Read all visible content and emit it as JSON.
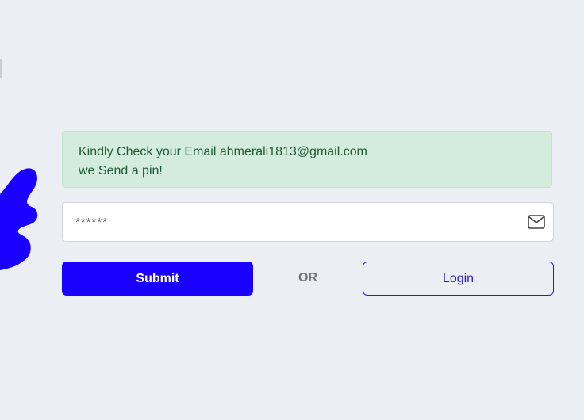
{
  "alert": {
    "line1": "Kindly Check your Email ahmerali1813@gmail.com",
    "line2": "we Send a pin!"
  },
  "pin_input": {
    "placeholder": "******",
    "value": "",
    "icon": "mail-icon"
  },
  "actions": {
    "submit_label": "Submit",
    "separator": "OR",
    "login_label": "Login"
  },
  "colors": {
    "primary": "#1a00ff",
    "alert_bg": "#d3ecdc",
    "alert_text": "#1f5a35",
    "page_bg": "#ebeef3"
  }
}
